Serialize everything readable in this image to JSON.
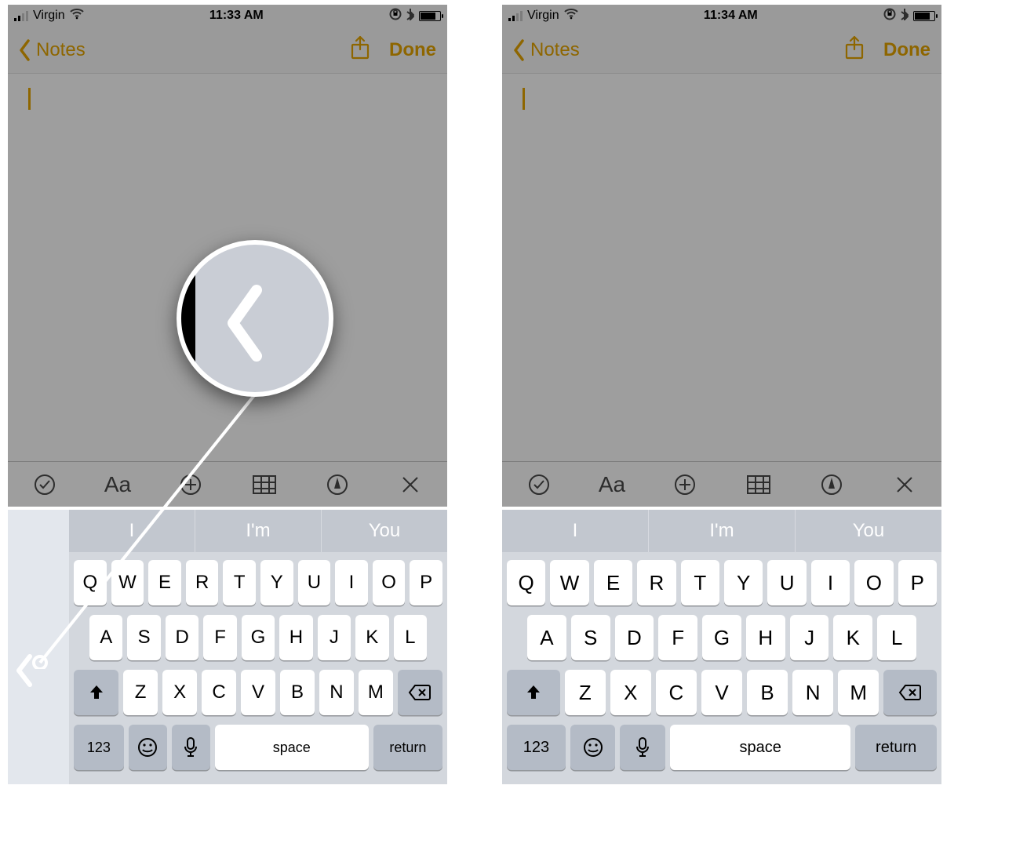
{
  "left": {
    "status": {
      "carrier": "Virgin",
      "time": "11:33 AM"
    },
    "nav": {
      "back": "Notes",
      "done": "Done"
    },
    "format": {
      "aa": "Aa"
    },
    "suggest": [
      "I",
      "I'm",
      "You"
    ],
    "rows": {
      "r1": [
        "Q",
        "W",
        "E",
        "R",
        "T",
        "Y",
        "U",
        "I",
        "O",
        "P"
      ],
      "r2": [
        "A",
        "S",
        "D",
        "F",
        "G",
        "H",
        "J",
        "K",
        "L"
      ],
      "r3": [
        "Z",
        "X",
        "C",
        "V",
        "B",
        "N",
        "M"
      ]
    },
    "bottom": {
      "k123": "123",
      "space": "space",
      "ret": "return"
    }
  },
  "right": {
    "status": {
      "carrier": "Virgin",
      "time": "11:34 AM"
    },
    "nav": {
      "back": "Notes",
      "done": "Done"
    },
    "format": {
      "aa": "Aa"
    },
    "suggest": [
      "I",
      "I'm",
      "You"
    ],
    "rows": {
      "r1": [
        "Q",
        "W",
        "E",
        "R",
        "T",
        "Y",
        "U",
        "I",
        "O",
        "P"
      ],
      "r2": [
        "A",
        "S",
        "D",
        "F",
        "G",
        "H",
        "J",
        "K",
        "L"
      ],
      "r3": [
        "Z",
        "X",
        "C",
        "V",
        "B",
        "N",
        "M"
      ]
    },
    "bottom": {
      "k123": "123",
      "space": "space",
      "ret": "return"
    }
  }
}
